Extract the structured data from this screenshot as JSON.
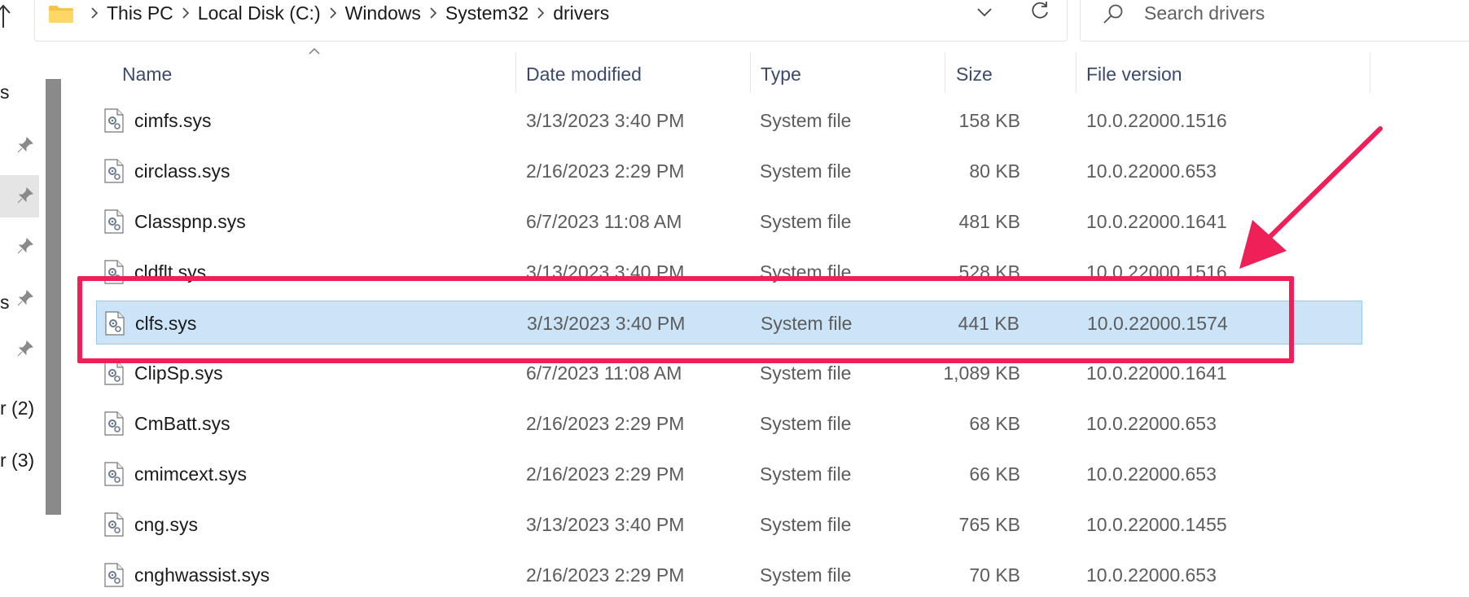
{
  "address_bar": {
    "breadcrumbs": [
      "This PC",
      "Local Disk (C:)",
      "Windows",
      "System32",
      "drivers"
    ]
  },
  "search": {
    "placeholder": "Search drivers"
  },
  "nav_pane": {
    "fragments": [
      "s",
      "s",
      "r (2)",
      "r (3)"
    ]
  },
  "columns": {
    "name": "Name",
    "date": "Date modified",
    "type": "Type",
    "size": "Size",
    "version": "File version"
  },
  "files": [
    {
      "name": "cimfs.sys",
      "date": "3/13/2023 3:40 PM",
      "type": "System file",
      "size": "158 KB",
      "version": "10.0.22000.1516",
      "selected": false
    },
    {
      "name": "circlass.sys",
      "date": "2/16/2023 2:29 PM",
      "type": "System file",
      "size": "80 KB",
      "version": "10.0.22000.653",
      "selected": false
    },
    {
      "name": "Classpnp.sys",
      "date": "6/7/2023 11:08 AM",
      "type": "System file",
      "size": "481 KB",
      "version": "10.0.22000.1641",
      "selected": false
    },
    {
      "name": "cldflt.sys",
      "date": "3/13/2023 3:40 PM",
      "type": "System file",
      "size": "528 KB",
      "version": "10.0.22000.1516",
      "selected": false
    },
    {
      "name": "clfs.sys",
      "date": "3/13/2023 3:40 PM",
      "type": "System file",
      "size": "441 KB",
      "version": "10.0.22000.1574",
      "selected": true
    },
    {
      "name": "ClipSp.sys",
      "date": "6/7/2023 11:08 AM",
      "type": "System file",
      "size": "1,089 KB",
      "version": "10.0.22000.1641",
      "selected": false
    },
    {
      "name": "CmBatt.sys",
      "date": "2/16/2023 2:29 PM",
      "type": "System file",
      "size": "68 KB",
      "version": "10.0.22000.653",
      "selected": false
    },
    {
      "name": "cmimcext.sys",
      "date": "2/16/2023 2:29 PM",
      "type": "System file",
      "size": "66 KB",
      "version": "10.0.22000.653",
      "selected": false
    },
    {
      "name": "cng.sys",
      "date": "3/13/2023 3:40 PM",
      "type": "System file",
      "size": "765 KB",
      "version": "10.0.22000.1455",
      "selected": false
    },
    {
      "name": "cnghwassist.sys",
      "date": "2/16/2023 2:29 PM",
      "type": "System file",
      "size": "70 KB",
      "version": "10.0.22000.653",
      "selected": false
    }
  ],
  "colors": {
    "selection_fill": "#cce4f7",
    "selection_border": "#99c9ef",
    "annotation": "#ef1f57",
    "header_text": "#3b4a6b"
  }
}
